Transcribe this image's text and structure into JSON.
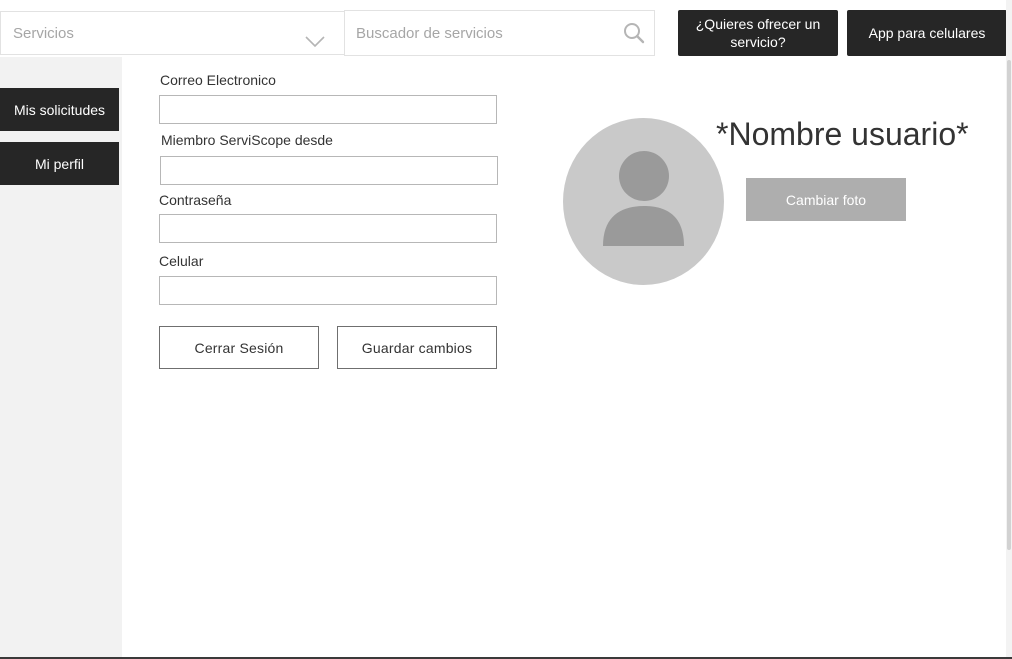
{
  "header": {
    "category_select": {
      "value": "Servicios",
      "icon": "chevron-down-icon"
    },
    "search": {
      "placeholder": "Buscador de servicios",
      "icon": "search-icon"
    },
    "offer_service_button": "¿Quieres ofrecer un servicio?",
    "mobile_app_button": "App para celulares"
  },
  "sidebar": {
    "items": [
      {
        "label": "Mis solicitudes"
      },
      {
        "label": "Mi perfil"
      }
    ]
  },
  "profile_form": {
    "fields": [
      {
        "label": "Correo Electronico",
        "value": ""
      },
      {
        "label": "Miembro ServiScope desde",
        "value": ""
      },
      {
        "label": "Contraseña",
        "value": ""
      },
      {
        "label": "Celular",
        "value": ""
      }
    ],
    "logout_button": "Cerrar Sesión",
    "save_button": "Guardar cambios"
  },
  "profile": {
    "username": "*Nombre usuario*",
    "change_photo_button": "Cambiar foto",
    "avatar_icon": "user-silhouette-icon"
  },
  "colors": {
    "dark_button": "#262626",
    "sidebar_bg": "#f2f2f2",
    "avatar_bg": "#c9c9c9",
    "disabled_button": "#aeaeae"
  }
}
